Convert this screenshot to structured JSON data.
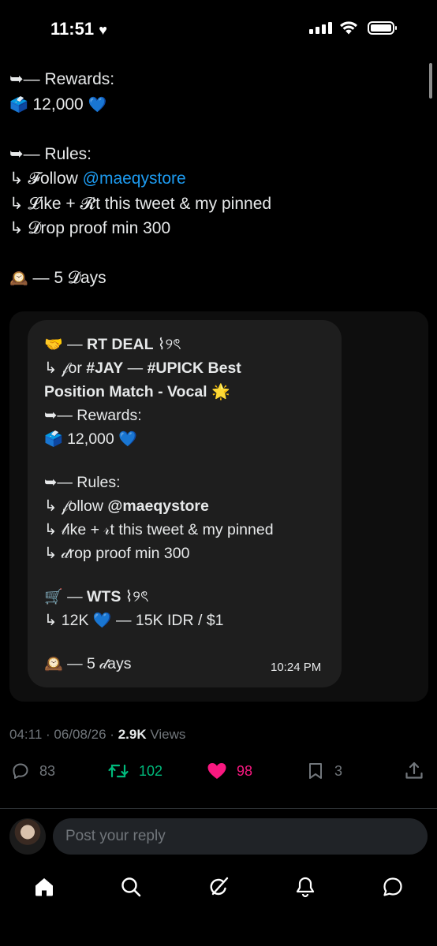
{
  "status_bar": {
    "time": "11:51",
    "heart": "♥"
  },
  "tweet": {
    "lines": [
      {
        "arrow": "➥",
        "text": "— Rewards:"
      },
      {
        "emoji": "🗳️",
        "text": " 12,000 ",
        "emoji2": "💙"
      },
      {
        "arrow": "➥",
        "text": "— Rules:"
      },
      {
        "prefix": "↳ ",
        "fancy": "𝓕",
        "text": "ollow ",
        "mention": "@maeqystore"
      },
      {
        "prefix": "↳ ",
        "fancy": "𝓛",
        "text": "ike + ",
        "fancy2": "𝓡",
        "text2": "t this tweet & my pinned"
      },
      {
        "prefix": "↳ ",
        "fancy": "𝓓",
        "text": "rop proof min 300"
      },
      {
        "emoji": "🕰️",
        "text": " — 5 ",
        "fancy": "𝓓",
        "text2": "ays"
      }
    ]
  },
  "quote": {
    "l1": {
      "emoji": "🤝",
      "pre": " — ",
      "bold": "RT DEAL",
      "post": " ⌇୨ৎ"
    },
    "l2": {
      "prefix": "↳ ",
      "fancy": "𝒻",
      "text": "or ",
      "bold1": "#JAY",
      "mid": " — ",
      "bold2": "#UPICK Best"
    },
    "l3": {
      "bold": "Position Match - Vocal ",
      "emoji": "🌟"
    },
    "l4": {
      "arrow": "➥",
      "text": "— Rewards:"
    },
    "l5": {
      "emoji": "🗳️",
      "text": " 12,000 ",
      "emoji2": "💙"
    },
    "l6": {
      "arrow": "➥",
      "text": "— Rules:"
    },
    "l7": {
      "prefix": "↳ ",
      "fancy": "𝒻",
      "text": "ollow ",
      "bold": "@maeqystore"
    },
    "l8": {
      "prefix": "↳ ",
      "fancy": "𝓁",
      "text": "ike + ",
      "fancy2": "𝓇",
      "text2": "t this tweet & my pinned"
    },
    "l9": {
      "prefix": "↳ ",
      "fancy": "𝒹",
      "text": "rop proof min 300"
    },
    "l10": {
      "emoji": "🛒",
      "pre": " — ",
      "bold": "WTS",
      "post": " ⌇୨ৎ"
    },
    "l11": {
      "prefix": "↳ 12K ",
      "emoji": "💙",
      "text": " — 15K IDR / $1"
    },
    "l12": {
      "emoji": "🕰️",
      "text": " — 5 ",
      "fancy": "𝒹",
      "text2": "ays"
    },
    "time": "10:24 PM"
  },
  "meta": {
    "time": "04:11",
    "date": "06/08/26",
    "sep": " · ",
    "views_count": "2.9K",
    "views_label": " Views"
  },
  "actions": {
    "replies": "83",
    "reposts": "102",
    "likes": "98",
    "bookmarks": "3"
  },
  "reply": {
    "placeholder": "Post your reply"
  },
  "colors": {
    "accent": "#1d9bf0",
    "repost": "#00ba7c",
    "like": "#f91880",
    "muted": "#71767b"
  },
  "icons": [
    "reply-icon",
    "repost-icon",
    "heart-icon",
    "bookmark-icon",
    "share-icon",
    "home-icon",
    "search-icon",
    "grok-icon",
    "notifications-icon",
    "messages-icon"
  ]
}
